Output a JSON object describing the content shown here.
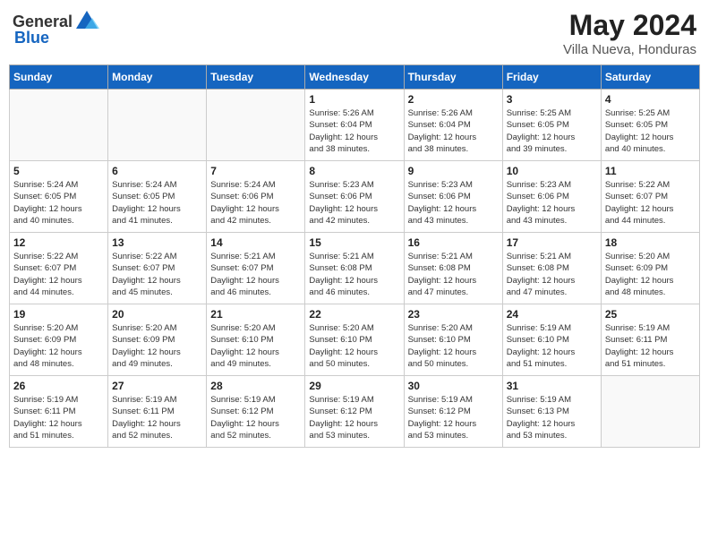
{
  "header": {
    "logo_general": "General",
    "logo_blue": "Blue",
    "month_title": "May 2024",
    "subtitle": "Villa Nueva, Honduras"
  },
  "weekdays": [
    "Sunday",
    "Monday",
    "Tuesday",
    "Wednesday",
    "Thursday",
    "Friday",
    "Saturday"
  ],
  "weeks": [
    [
      {
        "day": "",
        "info": ""
      },
      {
        "day": "",
        "info": ""
      },
      {
        "day": "",
        "info": ""
      },
      {
        "day": "1",
        "info": "Sunrise: 5:26 AM\nSunset: 6:04 PM\nDaylight: 12 hours\nand 38 minutes."
      },
      {
        "day": "2",
        "info": "Sunrise: 5:26 AM\nSunset: 6:04 PM\nDaylight: 12 hours\nand 38 minutes."
      },
      {
        "day": "3",
        "info": "Sunrise: 5:25 AM\nSunset: 6:05 PM\nDaylight: 12 hours\nand 39 minutes."
      },
      {
        "day": "4",
        "info": "Sunrise: 5:25 AM\nSunset: 6:05 PM\nDaylight: 12 hours\nand 40 minutes."
      }
    ],
    [
      {
        "day": "5",
        "info": "Sunrise: 5:24 AM\nSunset: 6:05 PM\nDaylight: 12 hours\nand 40 minutes."
      },
      {
        "day": "6",
        "info": "Sunrise: 5:24 AM\nSunset: 6:05 PM\nDaylight: 12 hours\nand 41 minutes."
      },
      {
        "day": "7",
        "info": "Sunrise: 5:24 AM\nSunset: 6:06 PM\nDaylight: 12 hours\nand 42 minutes."
      },
      {
        "day": "8",
        "info": "Sunrise: 5:23 AM\nSunset: 6:06 PM\nDaylight: 12 hours\nand 42 minutes."
      },
      {
        "day": "9",
        "info": "Sunrise: 5:23 AM\nSunset: 6:06 PM\nDaylight: 12 hours\nand 43 minutes."
      },
      {
        "day": "10",
        "info": "Sunrise: 5:23 AM\nSunset: 6:06 PM\nDaylight: 12 hours\nand 43 minutes."
      },
      {
        "day": "11",
        "info": "Sunrise: 5:22 AM\nSunset: 6:07 PM\nDaylight: 12 hours\nand 44 minutes."
      }
    ],
    [
      {
        "day": "12",
        "info": "Sunrise: 5:22 AM\nSunset: 6:07 PM\nDaylight: 12 hours\nand 44 minutes."
      },
      {
        "day": "13",
        "info": "Sunrise: 5:22 AM\nSunset: 6:07 PM\nDaylight: 12 hours\nand 45 minutes."
      },
      {
        "day": "14",
        "info": "Sunrise: 5:21 AM\nSunset: 6:07 PM\nDaylight: 12 hours\nand 46 minutes."
      },
      {
        "day": "15",
        "info": "Sunrise: 5:21 AM\nSunset: 6:08 PM\nDaylight: 12 hours\nand 46 minutes."
      },
      {
        "day": "16",
        "info": "Sunrise: 5:21 AM\nSunset: 6:08 PM\nDaylight: 12 hours\nand 47 minutes."
      },
      {
        "day": "17",
        "info": "Sunrise: 5:21 AM\nSunset: 6:08 PM\nDaylight: 12 hours\nand 47 minutes."
      },
      {
        "day": "18",
        "info": "Sunrise: 5:20 AM\nSunset: 6:09 PM\nDaylight: 12 hours\nand 48 minutes."
      }
    ],
    [
      {
        "day": "19",
        "info": "Sunrise: 5:20 AM\nSunset: 6:09 PM\nDaylight: 12 hours\nand 48 minutes."
      },
      {
        "day": "20",
        "info": "Sunrise: 5:20 AM\nSunset: 6:09 PM\nDaylight: 12 hours\nand 49 minutes."
      },
      {
        "day": "21",
        "info": "Sunrise: 5:20 AM\nSunset: 6:10 PM\nDaylight: 12 hours\nand 49 minutes."
      },
      {
        "day": "22",
        "info": "Sunrise: 5:20 AM\nSunset: 6:10 PM\nDaylight: 12 hours\nand 50 minutes."
      },
      {
        "day": "23",
        "info": "Sunrise: 5:20 AM\nSunset: 6:10 PM\nDaylight: 12 hours\nand 50 minutes."
      },
      {
        "day": "24",
        "info": "Sunrise: 5:19 AM\nSunset: 6:10 PM\nDaylight: 12 hours\nand 51 minutes."
      },
      {
        "day": "25",
        "info": "Sunrise: 5:19 AM\nSunset: 6:11 PM\nDaylight: 12 hours\nand 51 minutes."
      }
    ],
    [
      {
        "day": "26",
        "info": "Sunrise: 5:19 AM\nSunset: 6:11 PM\nDaylight: 12 hours\nand 51 minutes."
      },
      {
        "day": "27",
        "info": "Sunrise: 5:19 AM\nSunset: 6:11 PM\nDaylight: 12 hours\nand 52 minutes."
      },
      {
        "day": "28",
        "info": "Sunrise: 5:19 AM\nSunset: 6:12 PM\nDaylight: 12 hours\nand 52 minutes."
      },
      {
        "day": "29",
        "info": "Sunrise: 5:19 AM\nSunset: 6:12 PM\nDaylight: 12 hours\nand 53 minutes."
      },
      {
        "day": "30",
        "info": "Sunrise: 5:19 AM\nSunset: 6:12 PM\nDaylight: 12 hours\nand 53 minutes."
      },
      {
        "day": "31",
        "info": "Sunrise: 5:19 AM\nSunset: 6:13 PM\nDaylight: 12 hours\nand 53 minutes."
      },
      {
        "day": "",
        "info": ""
      }
    ]
  ]
}
